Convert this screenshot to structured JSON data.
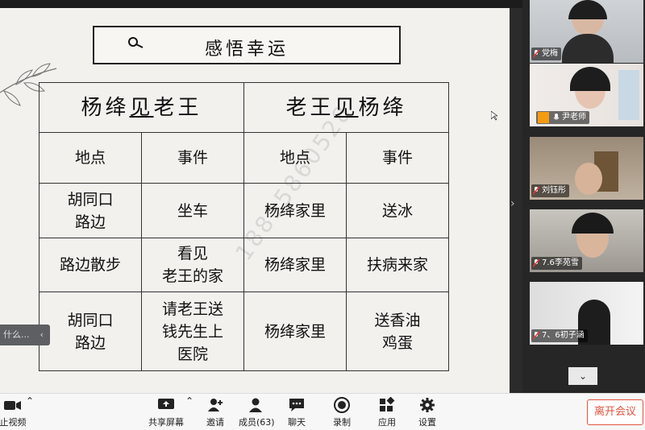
{
  "slide": {
    "title": "感悟幸运",
    "watermark": "18815860528",
    "table": {
      "headers": [
        "杨绛见老王",
        "老王见杨绛"
      ],
      "subheaders": [
        "地点",
        "事件",
        "地点",
        "事件"
      ],
      "rows": [
        [
          "胡同口\n路边",
          "坐车",
          "杨绛家里",
          "送冰"
        ],
        [
          "路边散步",
          "看见\n老王的家",
          "杨绛家里",
          "扶病来家"
        ],
        [
          "胡同口\n路边",
          "请老王送\n钱先生上\n医院",
          "杨绛家里",
          "送香油\n鸡蛋"
        ]
      ]
    },
    "side_tab_text": "什么..."
  },
  "participants": [
    {
      "name": "党梅"
    },
    {
      "name": "尹老师"
    },
    {
      "name": "刘钰彤"
    },
    {
      "name": "7.6李苑雪"
    },
    {
      "name": "7、6初子涵"
    }
  ],
  "toolbar": {
    "stop_video": "止视频",
    "share_screen": "共享屏幕",
    "invite": "邀请",
    "members": "成员(63)",
    "chat": "聊天",
    "record": "录制",
    "apps": "应用",
    "settings": "设置",
    "leave": "离开会议"
  },
  "colors": {
    "leave": "#e0533d",
    "toolbar_bg": "#f7f7f7",
    "gallery_bg": "#262626"
  }
}
